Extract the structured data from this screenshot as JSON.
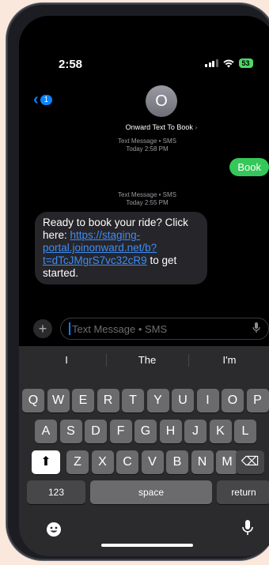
{
  "status": {
    "time": "2:58",
    "battery": "53"
  },
  "header": {
    "back_count": "1",
    "avatar_initial": "O",
    "contact_name": "Onward Text To Book",
    "contact_chevron": "›"
  },
  "messages": [
    {
      "meta_line1": "Text Message • SMS",
      "meta_line2": "Today 2:58 PM",
      "direction": "outgoing",
      "text": "Book"
    },
    {
      "meta_line1": "Text Message • SMS",
      "meta_line2": "Today 2:55 PM",
      "direction": "incoming",
      "text_before": "Ready to book your ride? Click here: ",
      "link": "https://staging-portal.joinonward.net/b?t=dTcJMgrS7vc32cR9",
      "link_display": "https://staging-portal.joinonward.net/b?t=dTcJMgrS7vc32cR9",
      "text_after": " to get started."
    }
  ],
  "compose": {
    "plus_label": "+",
    "placeholder": "Text Message • SMS"
  },
  "keyboard": {
    "suggestions": [
      "I",
      "The",
      "I'm"
    ],
    "row1": [
      "Q",
      "W",
      "E",
      "R",
      "T",
      "Y",
      "U",
      "I",
      "O",
      "P"
    ],
    "row2": [
      "A",
      "S",
      "D",
      "F",
      "G",
      "H",
      "J",
      "K",
      "L"
    ],
    "row3": [
      "Z",
      "X",
      "C",
      "V",
      "B",
      "N",
      "M"
    ],
    "numbers_label": "123",
    "space_label": "space",
    "return_label": "return",
    "shift_symbol": "⬆",
    "delete_symbol": "⌫"
  },
  "icons": {
    "back": "chevron-left-icon",
    "wifi": "wifi-icon",
    "signal": "cellular-signal-icon",
    "battery": "battery-icon",
    "emoji": "emoji-icon",
    "mic": "microphone-icon"
  },
  "colors": {
    "accent": "#0a84ff",
    "outgoing_bubble": "#35c759",
    "incoming_bubble": "#26252a",
    "link": "#3d8df7"
  }
}
